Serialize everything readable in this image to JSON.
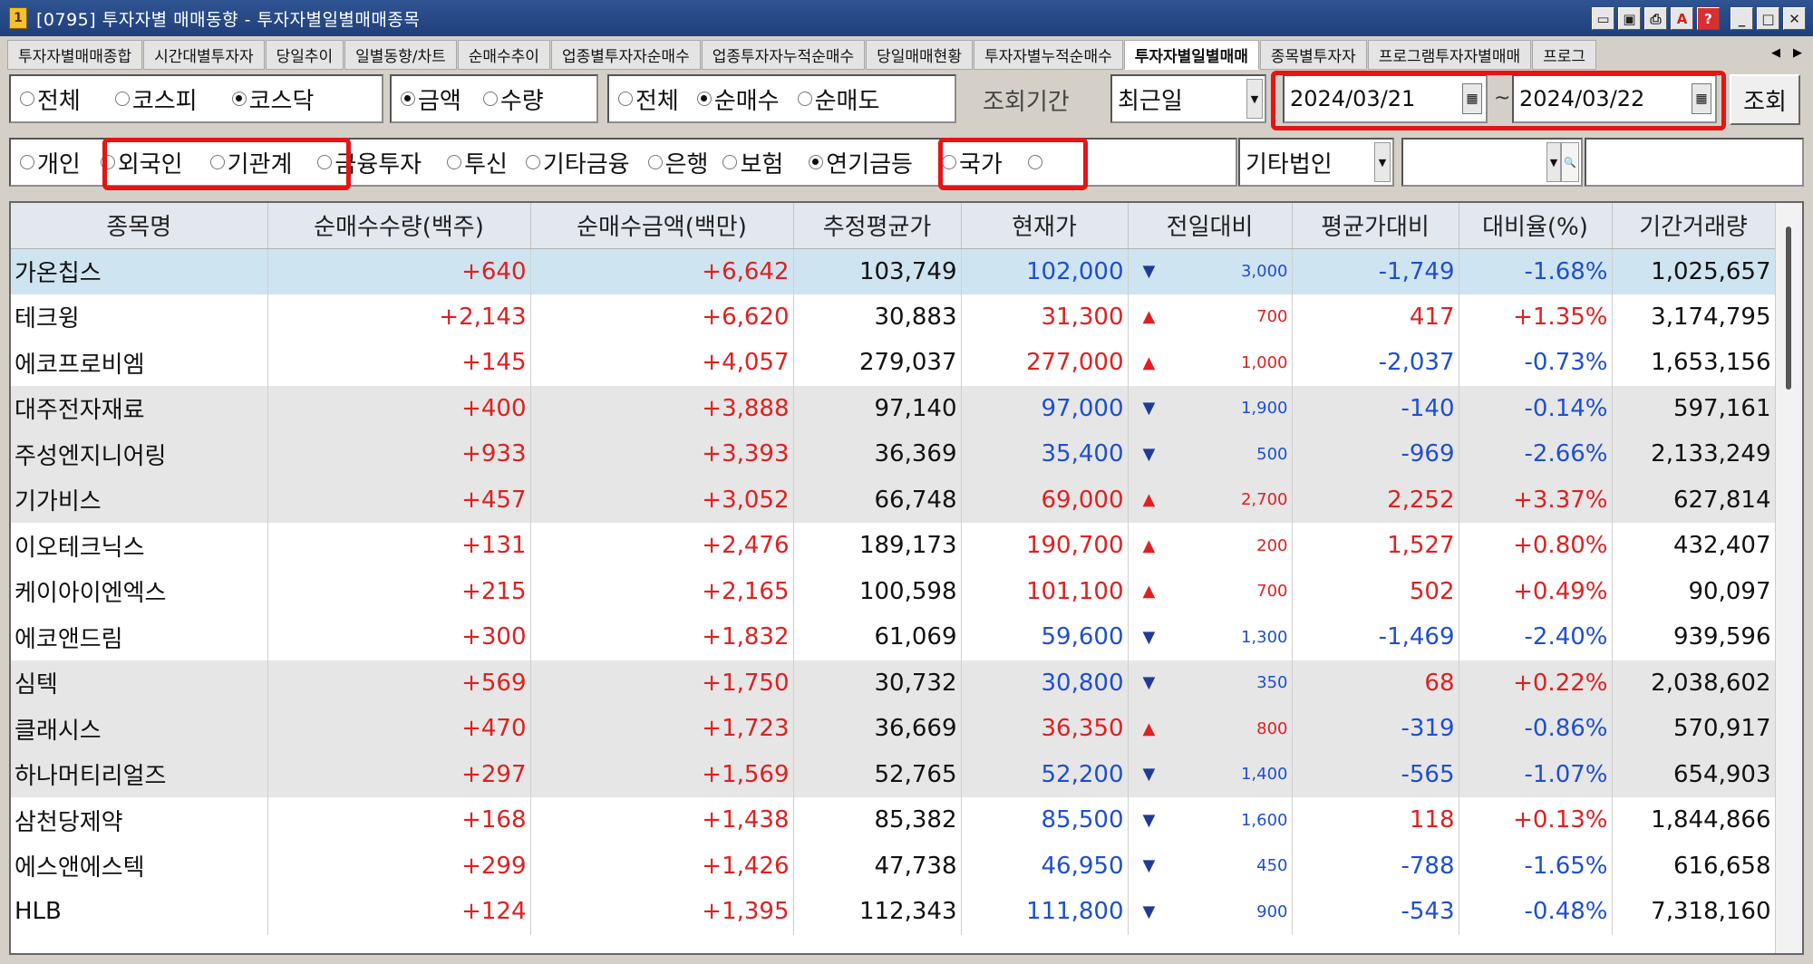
{
  "window": {
    "title": "[0795] 투자자별 매매동향 - 투자자별일별매매종목",
    "app_icon": "1"
  },
  "tabs": [
    {
      "label": "투자자별매매종합"
    },
    {
      "label": "시간대별투자자"
    },
    {
      "label": "당일추이"
    },
    {
      "label": "일별동향/차트"
    },
    {
      "label": "순매수추이"
    },
    {
      "label": "업종별투자자순매수"
    },
    {
      "label": "업종투자자누적순매수"
    },
    {
      "label": "당일매매현황"
    },
    {
      "label": "투자자별누적순매수"
    },
    {
      "label": "투자자별일별매매"
    },
    {
      "label": "종목별투자자"
    },
    {
      "label": "프로그램투자자별매매"
    },
    {
      "label": "프로그"
    }
  ],
  "filters": {
    "market": [
      "전체",
      "코스피",
      "코스닥"
    ],
    "unit": [
      "금액",
      "수량"
    ],
    "trade": [
      "전체",
      "순매수",
      "순매도"
    ],
    "period_label": "조회기간",
    "period_select": "최근일",
    "date_from": "2024/03/21",
    "date_sep": "~",
    "date_to": "2024/03/22",
    "search_button": "조회",
    "investors": [
      "개인",
      "외국인",
      "기관계",
      "금융투자",
      "투신",
      "기타금융",
      "은행",
      "보험",
      "연기금등",
      "국가",
      ""
    ],
    "other_select": "기타법인"
  },
  "table": {
    "headers": [
      "종목명",
      "순매수수량(백주)",
      "순매수금액(백만)",
      "추정평균가",
      "현재가",
      "전일대비",
      "평균가대비",
      "대비율(%)",
      "기간거래량"
    ],
    "rows": [
      {
        "name": "가온칩스",
        "qty": "+640",
        "amt": "+6,642",
        "avg": "103,749",
        "price": "102,000",
        "dir": "▼",
        "chg": "3,000",
        "avgdiff": "-1,749",
        "rate": "-1.68%",
        "vol": "1,025,657"
      },
      {
        "name": "테크윙",
        "qty": "+2,143",
        "amt": "+6,620",
        "avg": "30,883",
        "price": "31,300",
        "dir": "▲",
        "chg": "700",
        "avgdiff": "417",
        "rate": "+1.35%",
        "vol": "3,174,795"
      },
      {
        "name": "에코프로비엠",
        "qty": "+145",
        "amt": "+4,057",
        "avg": "279,037",
        "price": "277,000",
        "dir": "▲",
        "chg": "1,000",
        "avgdiff": "-2,037",
        "rate": "-0.73%",
        "vol": "1,653,156"
      },
      {
        "name": "대주전자재료",
        "qty": "+400",
        "amt": "+3,888",
        "avg": "97,140",
        "price": "97,000",
        "dir": "▼",
        "chg": "1,900",
        "avgdiff": "-140",
        "rate": "-0.14%",
        "vol": "597,161"
      },
      {
        "name": "주성엔지니어링",
        "qty": "+933",
        "amt": "+3,393",
        "avg": "36,369",
        "price": "35,400",
        "dir": "▼",
        "chg": "500",
        "avgdiff": "-969",
        "rate": "-2.66%",
        "vol": "2,133,249"
      },
      {
        "name": "기가비스",
        "qty": "+457",
        "amt": "+3,052",
        "avg": "66,748",
        "price": "69,000",
        "dir": "▲",
        "chg": "2,700",
        "avgdiff": "2,252",
        "rate": "+3.37%",
        "vol": "627,814"
      },
      {
        "name": "이오테크닉스",
        "qty": "+131",
        "amt": "+2,476",
        "avg": "189,173",
        "price": "190,700",
        "dir": "▲",
        "chg": "200",
        "avgdiff": "1,527",
        "rate": "+0.80%",
        "vol": "432,407"
      },
      {
        "name": "케이아이엔엑스",
        "qty": "+215",
        "amt": "+2,165",
        "avg": "100,598",
        "price": "101,100",
        "dir": "▲",
        "chg": "700",
        "avgdiff": "502",
        "rate": "+0.49%",
        "vol": "90,097"
      },
      {
        "name": "에코앤드림",
        "qty": "+300",
        "amt": "+1,832",
        "avg": "61,069",
        "price": "59,600",
        "dir": "▼",
        "chg": "1,300",
        "avgdiff": "-1,469",
        "rate": "-2.40%",
        "vol": "939,596"
      },
      {
        "name": "심텍",
        "qty": "+569",
        "amt": "+1,750",
        "avg": "30,732",
        "price": "30,800",
        "dir": "▼",
        "chg": "350",
        "avgdiff": "68",
        "rate": "+0.22%",
        "vol": "2,038,602"
      },
      {
        "name": "클래시스",
        "qty": "+470",
        "amt": "+1,723",
        "avg": "36,669",
        "price": "36,350",
        "dir": "▲",
        "chg": "800",
        "avgdiff": "-319",
        "rate": "-0.86%",
        "vol": "570,917"
      },
      {
        "name": "하나머티리얼즈",
        "qty": "+297",
        "amt": "+1,569",
        "avg": "52,765",
        "price": "52,200",
        "dir": "▼",
        "chg": "1,400",
        "avgdiff": "-565",
        "rate": "-1.07%",
        "vol": "654,903"
      },
      {
        "name": "삼천당제약",
        "qty": "+168",
        "amt": "+1,438",
        "avg": "85,382",
        "price": "85,500",
        "dir": "▼",
        "chg": "1,600",
        "avgdiff": "118",
        "rate": "+0.13%",
        "vol": "1,844,866"
      },
      {
        "name": "에스앤에스텍",
        "qty": "+299",
        "amt": "+1,426",
        "avg": "47,738",
        "price": "46,950",
        "dir": "▼",
        "chg": "450",
        "avgdiff": "-788",
        "rate": "-1.65%",
        "vol": "616,658"
      },
      {
        "name": "HLB",
        "qty": "+124",
        "amt": "+1,395",
        "avg": "112,343",
        "price": "111,800",
        "dir": "▼",
        "chg": "900",
        "avgdiff": "-543",
        "rate": "-0.48%",
        "vol": "7,318,160"
      }
    ]
  },
  "colors": {
    "up": "#e02020",
    "down": "#1e4fd2",
    "highlight": "#e61414",
    "selected_row": "#cfe4f1",
    "title_bar": "#2f5492"
  }
}
